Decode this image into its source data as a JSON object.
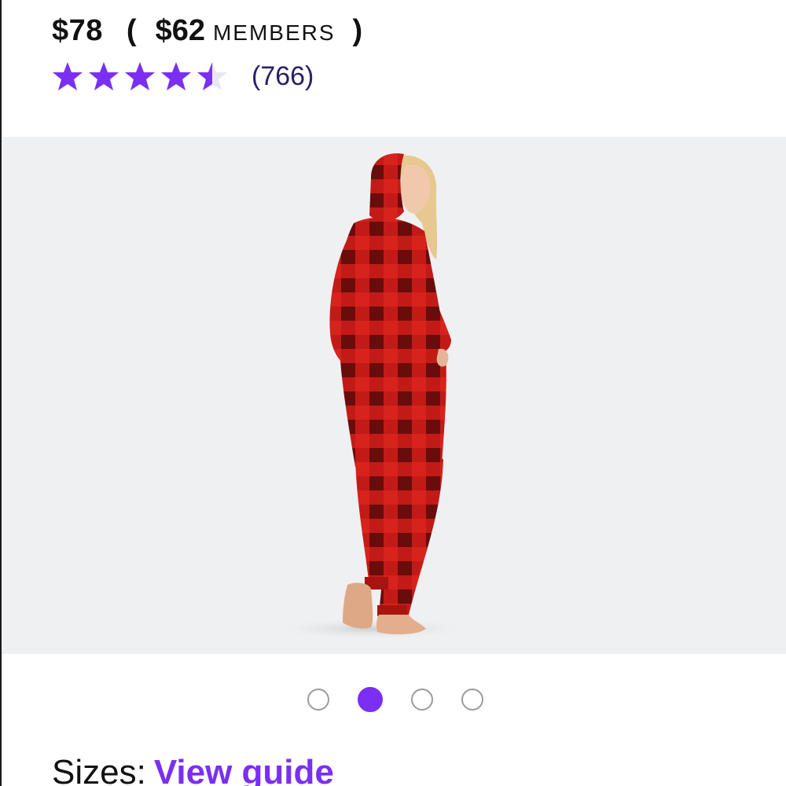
{
  "pricing": {
    "regular_price": "$78",
    "paren_open": "(",
    "member_price": "$62",
    "member_label": "MEMBERS",
    "paren_close": ")"
  },
  "rating": {
    "value": 4.5,
    "max": 5,
    "review_count": "(766)",
    "star_color": "#7b2ff2"
  },
  "gallery": {
    "image_subject": "Woman in red buffalo plaid hooded one-piece pajama, back view",
    "slide_count": 4,
    "active_index": 1,
    "active_dot_color": "#7b2ff2"
  },
  "sizes": {
    "label": "Sizes:",
    "guide_link": "View guide"
  }
}
